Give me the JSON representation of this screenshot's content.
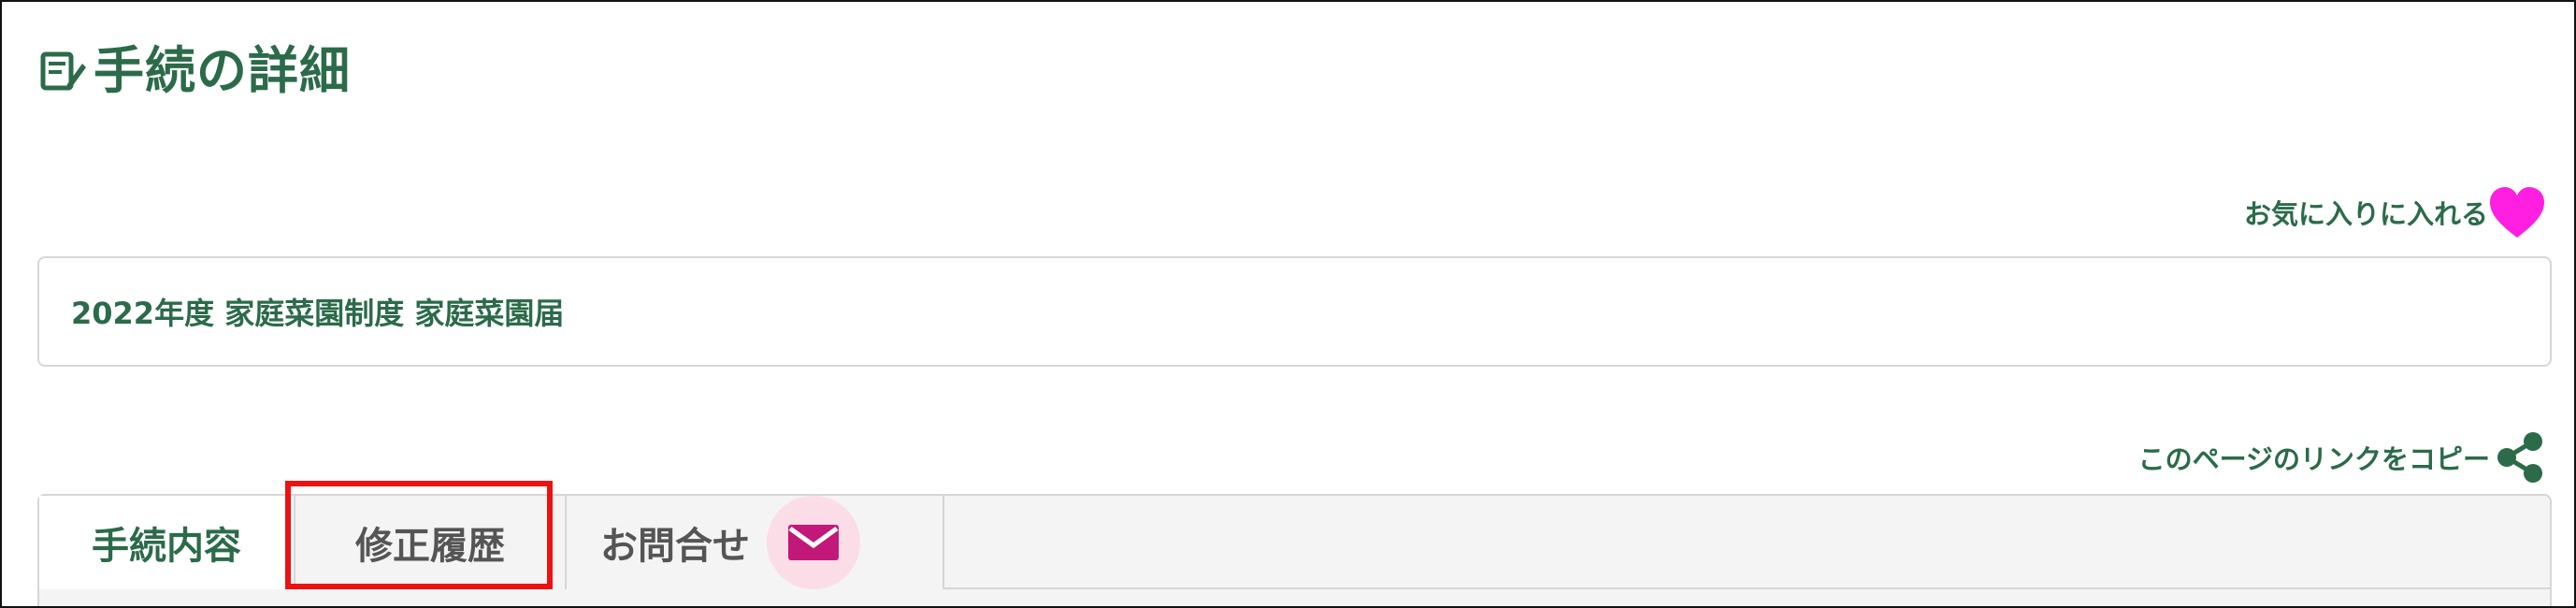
{
  "page": {
    "title": "手続の詳細",
    "favorite_label": "お気に入りに入れる",
    "procedure_name": "2022年度 家庭菜園制度 家庭菜園届",
    "copy_link_label": "このページのリンクをコピー"
  },
  "tabs": [
    {
      "label": "手続内容",
      "active": true
    },
    {
      "label": "修正履歴",
      "active": false,
      "highlighted": true
    },
    {
      "label": "お問合せ",
      "active": false,
      "icon": "mail-icon"
    }
  ],
  "icons": {
    "title": "document-edit-icon",
    "favorite": "heart-icon",
    "share": "share-icon",
    "inquiry": "mail-icon"
  },
  "colors": {
    "accent": "#2b6b49",
    "heart": "#ff1fe0",
    "mail": "#c2187a",
    "mail_badge": "#fbdde7",
    "highlight": "#ee1111"
  }
}
